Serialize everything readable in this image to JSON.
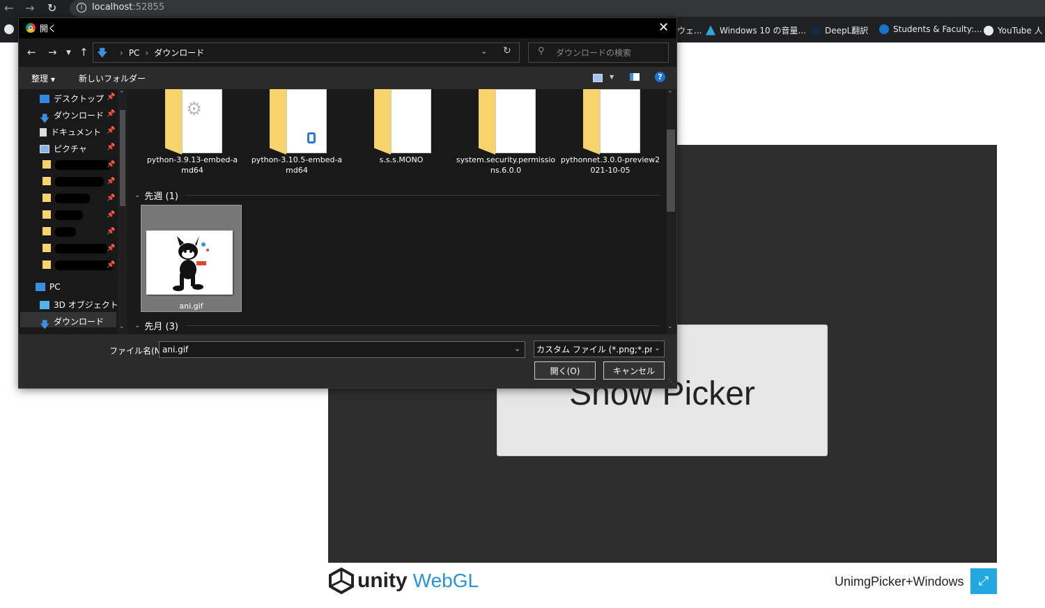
{
  "browser": {
    "url_host": "localhost",
    "url_port": ":52855",
    "bookmarks": [
      {
        "label": "ウェ..."
      },
      {
        "label": "Windows 10 の音量..."
      },
      {
        "label": "DeepL翻訳"
      },
      {
        "label": "Students & Faculty:..."
      },
      {
        "label": "YouTube 人"
      }
    ]
  },
  "dialog": {
    "title": "開く",
    "breadcrumbs": [
      "PC",
      "ダウンロード"
    ],
    "search_placeholder": "ダウンロードの検索",
    "toolbar": {
      "organize": "整理",
      "new_folder": "新しいフォルダー"
    },
    "nav_quick": [
      {
        "label": "デスクトップ"
      },
      {
        "label": "ダウンロード"
      },
      {
        "label": "ドキュメント"
      },
      {
        "label": "ピクチャ"
      }
    ],
    "nav_pc": {
      "label": "PC"
    },
    "nav_pc_children": [
      {
        "label": "3D オブジェクト"
      },
      {
        "label": "ダウンロード"
      }
    ],
    "folders": [
      {
        "name": "python-3.9.13-embed-a",
        "name2": "md64"
      },
      {
        "name": "python-3.10.5-embed-a",
        "name2": "md64"
      },
      {
        "name": "s.s.s.MONO",
        "name2": ""
      },
      {
        "name": "system.security.permissio",
        "name2": "ns.6.0.0"
      },
      {
        "name": "pythonnet.3.0.0-preview2",
        "name2": "021-10-05"
      }
    ],
    "groups": {
      "last_week": "先週 (1)",
      "last_month": "先月 (3)"
    },
    "selected_file": "ani.gif",
    "filename_label": "ファイル名(N):",
    "filename_value": "ani.gif",
    "filetype_value": "カスタム ファイル (*.png;*.png;*.jpg",
    "open_button": "開く(O)",
    "cancel_button": "キャンセル"
  },
  "unity": {
    "button_label": "Show Picker",
    "logo_unity": "unity",
    "logo_webgl": "WebGL",
    "build_title": "UnimgPicker+Windows"
  }
}
